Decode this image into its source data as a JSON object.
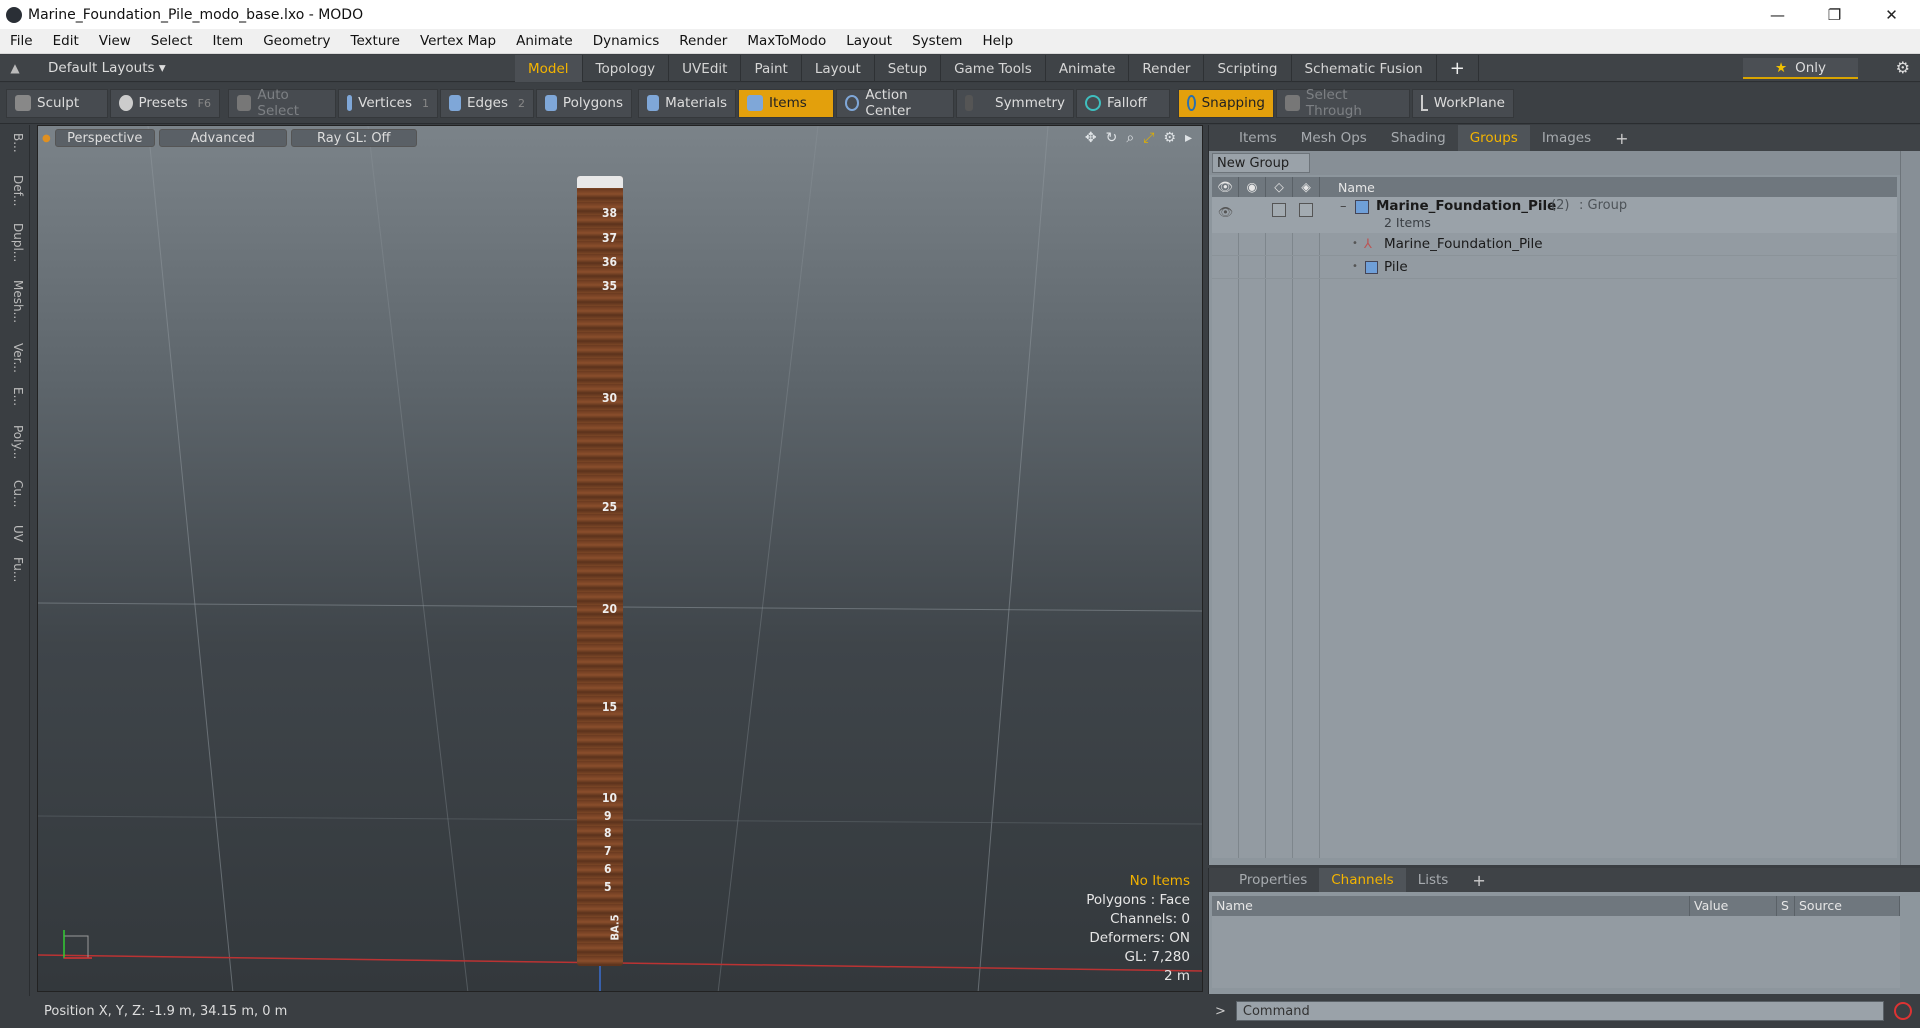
{
  "window": {
    "title": "Marine_Foundation_Pile_modo_base.lxo - MODO",
    "min": "—",
    "max": "❐",
    "close": "✕"
  },
  "menu": [
    "File",
    "Edit",
    "View",
    "Select",
    "Item",
    "Geometry",
    "Texture",
    "Vertex Map",
    "Animate",
    "Dynamics",
    "Render",
    "MaxToModo",
    "Layout",
    "System",
    "Help"
  ],
  "layouts": {
    "default": "Default Layouts ▾",
    "tabs": [
      "Model",
      "Topology",
      "UVEdit",
      "Paint",
      "Layout",
      "Setup",
      "Game Tools",
      "Animate",
      "Render",
      "Scripting",
      "Schematic Fusion"
    ],
    "active": "Model",
    "plus": "+",
    "only": "Only"
  },
  "toolbar": {
    "sculpt": "Sculpt",
    "presets": "Presets",
    "presets_key": "F6",
    "auto_select": "Auto Select",
    "vertices": "Vertices",
    "vertices_num": "1",
    "edges": "Edges",
    "edges_num": "2",
    "polygons": "Polygons",
    "materials": "Materials",
    "items": "Items",
    "action_center": "Action Center",
    "symmetry": "Symmetry",
    "falloff": "Falloff",
    "snapping": "Snapping",
    "select_through": "Select Through",
    "workplane": "WorkPlane"
  },
  "lefttabs": [
    "B...",
    "Def...",
    "Dupl...",
    "Mesh...",
    "Ver...",
    "E...",
    "Poly...",
    "Cu...",
    "UV",
    "Fu..."
  ],
  "viewport": {
    "perspective": "Perspective",
    "advanced": "Advanced",
    "raygl": "Ray GL: Off",
    "ticks": [
      "38",
      "37",
      "36",
      "35",
      "30",
      "25",
      "20",
      "15",
      "10",
      "9",
      "8",
      "7",
      "6",
      "5",
      "BA.5"
    ],
    "info": {
      "no_items": "No Items",
      "polygons": "Polygons : Face",
      "channels": "Channels: 0",
      "deformers": "Deformers: ON",
      "gl": "GL: 7,280",
      "scale": "2 m"
    }
  },
  "status": {
    "position": "Position X, Y, Z:   -1.9 m, 34.15 m, 0 m"
  },
  "groups_panel": {
    "tabs": [
      "Items",
      "Mesh Ops",
      "Shading",
      "Groups",
      "Images"
    ],
    "active": "Groups",
    "plus": "+",
    "new_group": "New Group",
    "header_name": "Name",
    "group": {
      "name": "Marine_Foundation_Pile",
      "count": "(2)",
      "kind": ": Group",
      "sub": "2 Items"
    },
    "children": [
      "Marine_Foundation_Pile",
      "Pile"
    ]
  },
  "channels_panel": {
    "tabs": [
      "Properties",
      "Channels",
      "Lists"
    ],
    "active": "Channels",
    "plus": "+",
    "columns": [
      "Name",
      "Value",
      "S",
      "Source"
    ]
  },
  "command": {
    "arrow": ">",
    "placeholder": "Command"
  }
}
